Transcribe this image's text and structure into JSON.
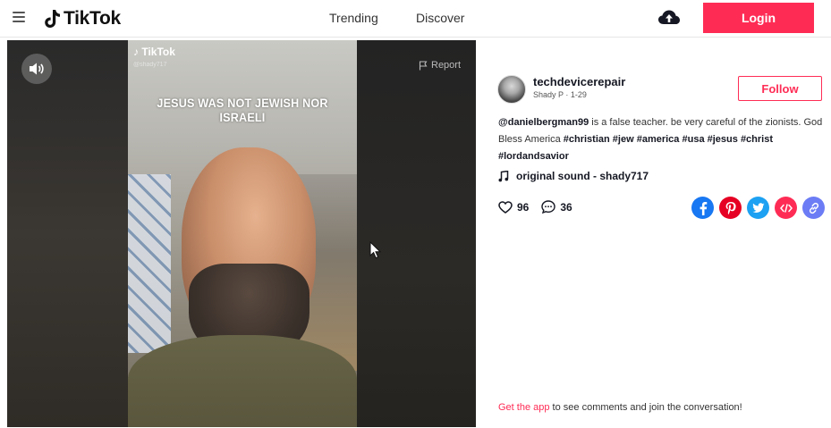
{
  "header": {
    "logo_text": "TikTok",
    "nav": [
      "Trending",
      "Discover"
    ],
    "login_label": "Login",
    "accent_color": "#fe2c55"
  },
  "video": {
    "watermark_logo": "TikTok",
    "watermark_user": "@shady717",
    "overlay_text": "JESUS WAS NOT JEWISH NOR ISRAELI",
    "report_label": "Report",
    "sound_icon": "volume-icon"
  },
  "post": {
    "username": "techdevicerepair",
    "subname": "Shady P · 1-29",
    "follow_label": "Follow",
    "mention": "@danielbergman99",
    "description_text": " is a false teacher. be very careful of the zionists. God Bless America ",
    "hashtags": [
      "#christian",
      "#jew",
      "#america",
      "#usa",
      "#jesus",
      "#christ",
      "#lordandsavior"
    ],
    "music": "original sound - shady717",
    "likes": "96",
    "comments": "36",
    "share_icons": [
      "facebook-icon",
      "pinterest-icon",
      "twitter-icon",
      "embed-icon",
      "link-icon"
    ],
    "share_colors": [
      "#1877f2",
      "#e60023",
      "#1da1f2",
      "#fe2c55",
      "#6b7cf5"
    ]
  },
  "footer": {
    "get_app_link": "Get the app",
    "get_app_text": " to see comments and join the conversation!"
  }
}
